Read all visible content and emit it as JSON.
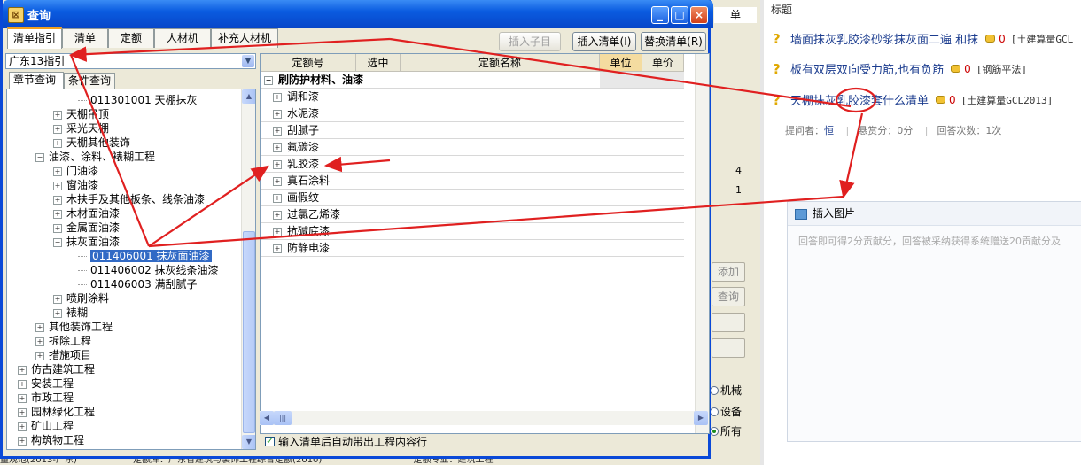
{
  "background_app": {
    "column_header": "单",
    "buttons": [
      "添加",
      "查询",
      "",
      ""
    ],
    "radios": [
      {
        "label": "机械",
        "checked": false
      },
      {
        "label": "设备",
        "checked": false
      },
      {
        "label": "所有",
        "checked": true
      }
    ],
    "row_numbers": [
      "4",
      "1"
    ],
    "status": {
      "left": "量规范(2013-广东)",
      "middle": "定额库：广东省建筑与装饰工程综合定额(2010)",
      "right": "定额专业：建筑工程"
    }
  },
  "browser": {
    "title": "标题",
    "questions": [
      {
        "text": "墙面抹灰乳胶漆砂浆抹灰面二遍 和抹",
        "count": "0",
        "category": "[土建算量GCL"
      },
      {
        "text": "板有双层双向受力筋,也有负筋",
        "count": "0",
        "category": "[钢筋平法]"
      },
      {
        "text": "天棚抹灰乳胶漆套什么清单",
        "count": "0",
        "category": "[土建算量GCL2013]"
      }
    ],
    "asker": {
      "label": "提问者：",
      "name": "恒",
      "reward": "悬赏分：0分",
      "answers": "回答次数：1次"
    },
    "insert_image": "插入图片",
    "answer_placeholder": "回答即可得2分贡献分，回答被采纳获得系统赠送20贡献分及"
  },
  "dialog": {
    "title": "查询",
    "title_icon_glyph": "⊠",
    "tabs": [
      {
        "label": "清单指引",
        "active": true
      },
      {
        "label": "清单",
        "active": false
      },
      {
        "label": "定额",
        "active": false
      },
      {
        "label": "人材机",
        "active": false
      },
      {
        "label": "补充人材机",
        "active": false
      }
    ],
    "buttons": {
      "insert_child": "插入子目",
      "insert_list": "插入清单(I)",
      "replace_list": "替换清单(R)"
    },
    "combo_value": "广东13指引",
    "subtabs": [
      {
        "label": "章节查询",
        "active": true
      },
      {
        "label": "条件查询",
        "active": false
      }
    ],
    "tree": [
      {
        "text": "011301001  天棚抹灰",
        "level": 4,
        "box": ""
      },
      {
        "text": "天棚吊顶",
        "level": 3,
        "box": "+"
      },
      {
        "text": "采光天棚",
        "level": 3,
        "box": "+"
      },
      {
        "text": "天棚其他装饰",
        "level": 3,
        "box": "+"
      },
      {
        "text": "油漆、涂料、裱糊工程",
        "level": 2,
        "box": "−"
      },
      {
        "text": "门油漆",
        "level": 3,
        "box": "+"
      },
      {
        "text": "窗油漆",
        "level": 3,
        "box": "+"
      },
      {
        "text": "木扶手及其他板条、线条油漆",
        "level": 3,
        "box": "+"
      },
      {
        "text": "木材面油漆",
        "level": 3,
        "box": "+"
      },
      {
        "text": "金属面油漆",
        "level": 3,
        "box": "+"
      },
      {
        "text": "抹灰面油漆",
        "level": 3,
        "box": "−"
      },
      {
        "text": "011406001  抹灰面油漆",
        "level": 4,
        "box": "",
        "selected": true
      },
      {
        "text": "011406002  抹灰线条油漆",
        "level": 4,
        "box": ""
      },
      {
        "text": "011406003  满刮腻子",
        "level": 4,
        "box": ""
      },
      {
        "text": "喷刷涂料",
        "level": 3,
        "box": "+"
      },
      {
        "text": "裱糊",
        "level": 3,
        "box": "+"
      },
      {
        "text": "其他装饰工程",
        "level": 2,
        "box": "+"
      },
      {
        "text": "拆除工程",
        "level": 2,
        "box": "+"
      },
      {
        "text": "措施项目",
        "level": 2,
        "box": "+"
      },
      {
        "text": "仿古建筑工程",
        "level": 1,
        "box": "+"
      },
      {
        "text": "安装工程",
        "level": 1,
        "box": "+"
      },
      {
        "text": "市政工程",
        "level": 1,
        "box": "+"
      },
      {
        "text": "园林绿化工程",
        "level": 1,
        "box": "+"
      },
      {
        "text": "矿山工程",
        "level": 1,
        "box": "+"
      },
      {
        "text": "构筑物工程",
        "level": 1,
        "box": "+"
      }
    ],
    "grid": {
      "headers": [
        "定额号",
        "选中",
        "定额名称",
        "单位",
        "单价"
      ],
      "group": "刷防护材料、油漆",
      "rows": [
        "调和漆",
        "水泥漆",
        "刮腻子",
        "氟碳漆",
        "乳胶漆",
        "真石涂料",
        "画假纹",
        "过氯乙烯漆",
        "抗碱底漆",
        "防静电漆"
      ]
    },
    "checkbox_label": "输入清单后自动带出工程内容行",
    "checkbox_checked": true
  },
  "colors": {
    "titlebar": "#0a5be0",
    "selection": "#316ac5",
    "arrow": "#e02020",
    "link": "#1c3d8f"
  }
}
